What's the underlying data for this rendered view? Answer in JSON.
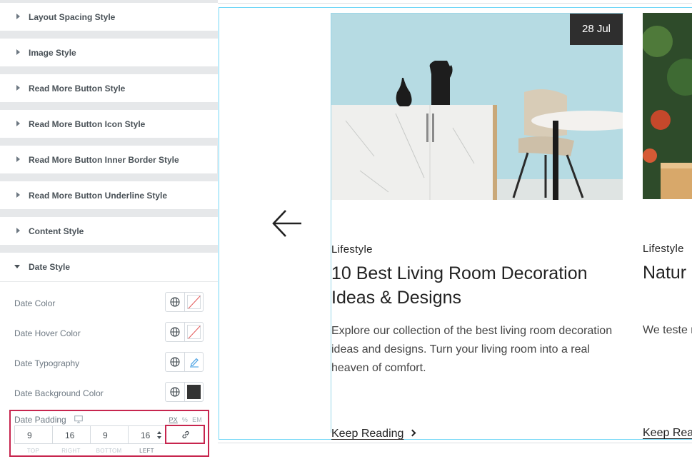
{
  "sections": [
    {
      "label": "Layout Spacing Style"
    },
    {
      "label": "Image Style"
    },
    {
      "label": "Read More Button Style"
    },
    {
      "label": "Read More Button Icon Style"
    },
    {
      "label": "Read More Button Inner Border Style"
    },
    {
      "label": "Read More Button Underline Style"
    },
    {
      "label": "Content Style"
    },
    {
      "label": "Date Style"
    }
  ],
  "date_style": {
    "date_color": "Date Color",
    "date_hover_color": "Date Hover Color",
    "date_typography": "Date Typography",
    "date_background_color": "Date Background Color",
    "background_swatch": "#333333",
    "padding": {
      "label": "Date Padding",
      "units": [
        "PX",
        "%",
        "EM"
      ],
      "active_unit": "PX",
      "top": "9",
      "right": "16",
      "bottom": "9",
      "left": "16",
      "top_label": "TOP",
      "right_label": "RIGHT",
      "bottom_label": "BOTTOM",
      "left_label": "LEFT"
    }
  },
  "preview": {
    "card1": {
      "date": "28 Jul",
      "category": "Lifestyle",
      "title": "10 Best Living Room Decoration Ideas & Designs",
      "excerpt": "Explore our collection of the best living room decoration ideas and designs. Turn your living room into a real heaven of comfort.",
      "read_more": "Keep Reading"
    },
    "card2": {
      "category": "Lifestyle",
      "title": "Natur Skin T",
      "excerpt": "We teste natural, c Glow up",
      "read_more": "Keep Rea"
    }
  },
  "colors": {
    "highlight": "#c7254e",
    "frame": "#71d7f7",
    "date_bg": "#2e2e2e"
  },
  "icons": [
    "caret-right-icon",
    "caret-down-icon",
    "globe-icon",
    "pencil-icon",
    "desktop-icon",
    "link-icon",
    "arrow-left-icon",
    "chevron-right-icon",
    "chevron-left-icon"
  ]
}
